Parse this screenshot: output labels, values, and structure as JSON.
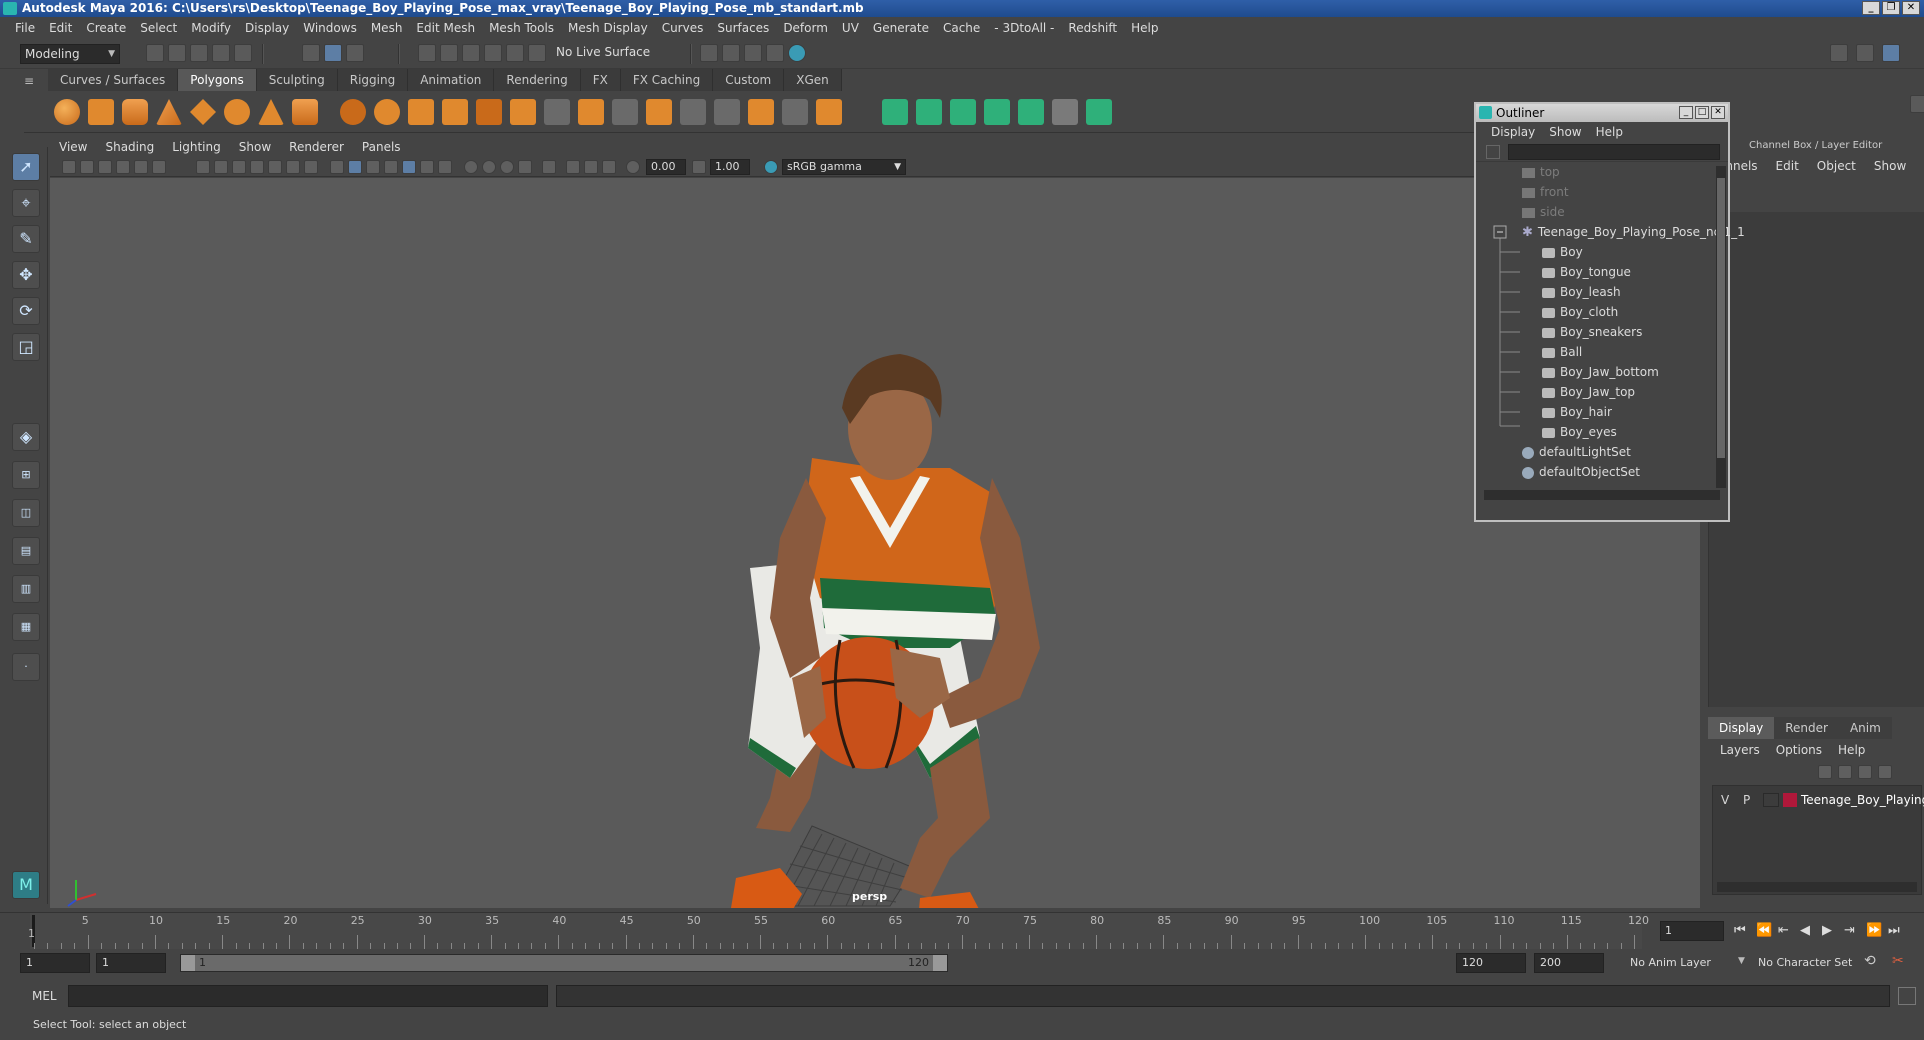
{
  "window": {
    "title": "Autodesk Maya 2016: C:\\Users\\rs\\Desktop\\Teenage_Boy_Playing_Pose_max_vray\\Teenage_Boy_Playing_Pose_mb_standart.mb"
  },
  "menubar": [
    "File",
    "Edit",
    "Create",
    "Select",
    "Modify",
    "Display",
    "Windows",
    "Mesh",
    "Edit Mesh",
    "Mesh Tools",
    "Mesh Display",
    "Curves",
    "Surfaces",
    "Deform",
    "UV",
    "Generate",
    "Cache",
    "- 3DtoAll -",
    "Redshift",
    "Help"
  ],
  "statusline": {
    "mode": "Modeling",
    "live_surface": "No Live Surface"
  },
  "shelf_tabs": [
    "Curves / Surfaces",
    "Polygons",
    "Sculpting",
    "Rigging",
    "Animation",
    "Rendering",
    "FX",
    "FX Caching",
    "Custom",
    "XGen"
  ],
  "shelf_active": "Polygons",
  "panel_menu": [
    "View",
    "Shading",
    "Lighting",
    "Show",
    "Renderer",
    "Panels"
  ],
  "panel_toolbar": {
    "exposure": "0.00",
    "gamma": "1.00",
    "colorspace": "sRGB gamma"
  },
  "viewport": {
    "camera_label": "persp"
  },
  "outliner": {
    "title": "Outliner",
    "menu": [
      "Display",
      "Show",
      "Help"
    ],
    "items": [
      {
        "label": "top",
        "kind": "camera",
        "dim": true,
        "indent": 0
      },
      {
        "label": "front",
        "kind": "camera",
        "dim": true,
        "indent": 0
      },
      {
        "label": "side",
        "kind": "camera",
        "dim": true,
        "indent": 0
      },
      {
        "label": "Teenage_Boy_Playing_Pose_ncl1_1",
        "kind": "group",
        "dim": false,
        "indent": 0
      },
      {
        "label": "Boy",
        "kind": "mesh",
        "dim": false,
        "indent": 1
      },
      {
        "label": "Boy_tongue",
        "kind": "mesh",
        "dim": false,
        "indent": 1
      },
      {
        "label": "Boy_leash",
        "kind": "mesh",
        "dim": false,
        "indent": 1
      },
      {
        "label": "Boy_cloth",
        "kind": "mesh",
        "dim": false,
        "indent": 1
      },
      {
        "label": "Boy_sneakers",
        "kind": "mesh",
        "dim": false,
        "indent": 1
      },
      {
        "label": "Ball",
        "kind": "mesh",
        "dim": false,
        "indent": 1
      },
      {
        "label": "Boy_Jaw_bottom",
        "kind": "mesh",
        "dim": false,
        "indent": 1
      },
      {
        "label": "Boy_Jaw_top",
        "kind": "mesh",
        "dim": false,
        "indent": 1
      },
      {
        "label": "Boy_hair",
        "kind": "mesh",
        "dim": false,
        "indent": 1
      },
      {
        "label": "Boy_eyes",
        "kind": "mesh",
        "dim": false,
        "indent": 1
      },
      {
        "label": "defaultLightSet",
        "kind": "set",
        "dim": false,
        "indent": 0
      },
      {
        "label": "defaultObjectSet",
        "kind": "set",
        "dim": false,
        "indent": 0
      }
    ]
  },
  "channelbox": {
    "title": "Channel Box / Layer Editor",
    "menu": [
      "annels",
      "Edit",
      "Object",
      "Show"
    ]
  },
  "layer_editor": {
    "tabs": [
      "Display",
      "Render",
      "Anim"
    ],
    "active_tab": "Display",
    "menu": [
      "Layers",
      "Options",
      "Help"
    ],
    "layer": {
      "v": "V",
      "p": "P",
      "name": "Teenage_Boy_Playing_",
      "color": "#b0183a"
    }
  },
  "timeline": {
    "ticks": [
      "5",
      "10",
      "15",
      "20",
      "25",
      "30",
      "35",
      "40",
      "45",
      "50",
      "55",
      "60",
      "65",
      "70",
      "75",
      "80",
      "85",
      "90",
      "95",
      "100",
      "105",
      "110",
      "115",
      "120"
    ],
    "start_label": "1",
    "current_frame": "1"
  },
  "range": {
    "start": "1",
    "anim_start": "1",
    "slider_start": "1",
    "slider_end": "120",
    "anim_end": "120",
    "end": "200",
    "anim_layer": "No Anim Layer",
    "character_set": "No Character Set"
  },
  "cmdline": {
    "label": "MEL"
  },
  "helpline": {
    "text": "Select Tool: select an object"
  },
  "colors": {
    "accent": "#5d7ea5",
    "shelf_orange": "#e0892e",
    "shelf_green": "#2fb07a",
    "jersey_orange": "#d0661a",
    "jersey_green": "#1f6b3a"
  }
}
